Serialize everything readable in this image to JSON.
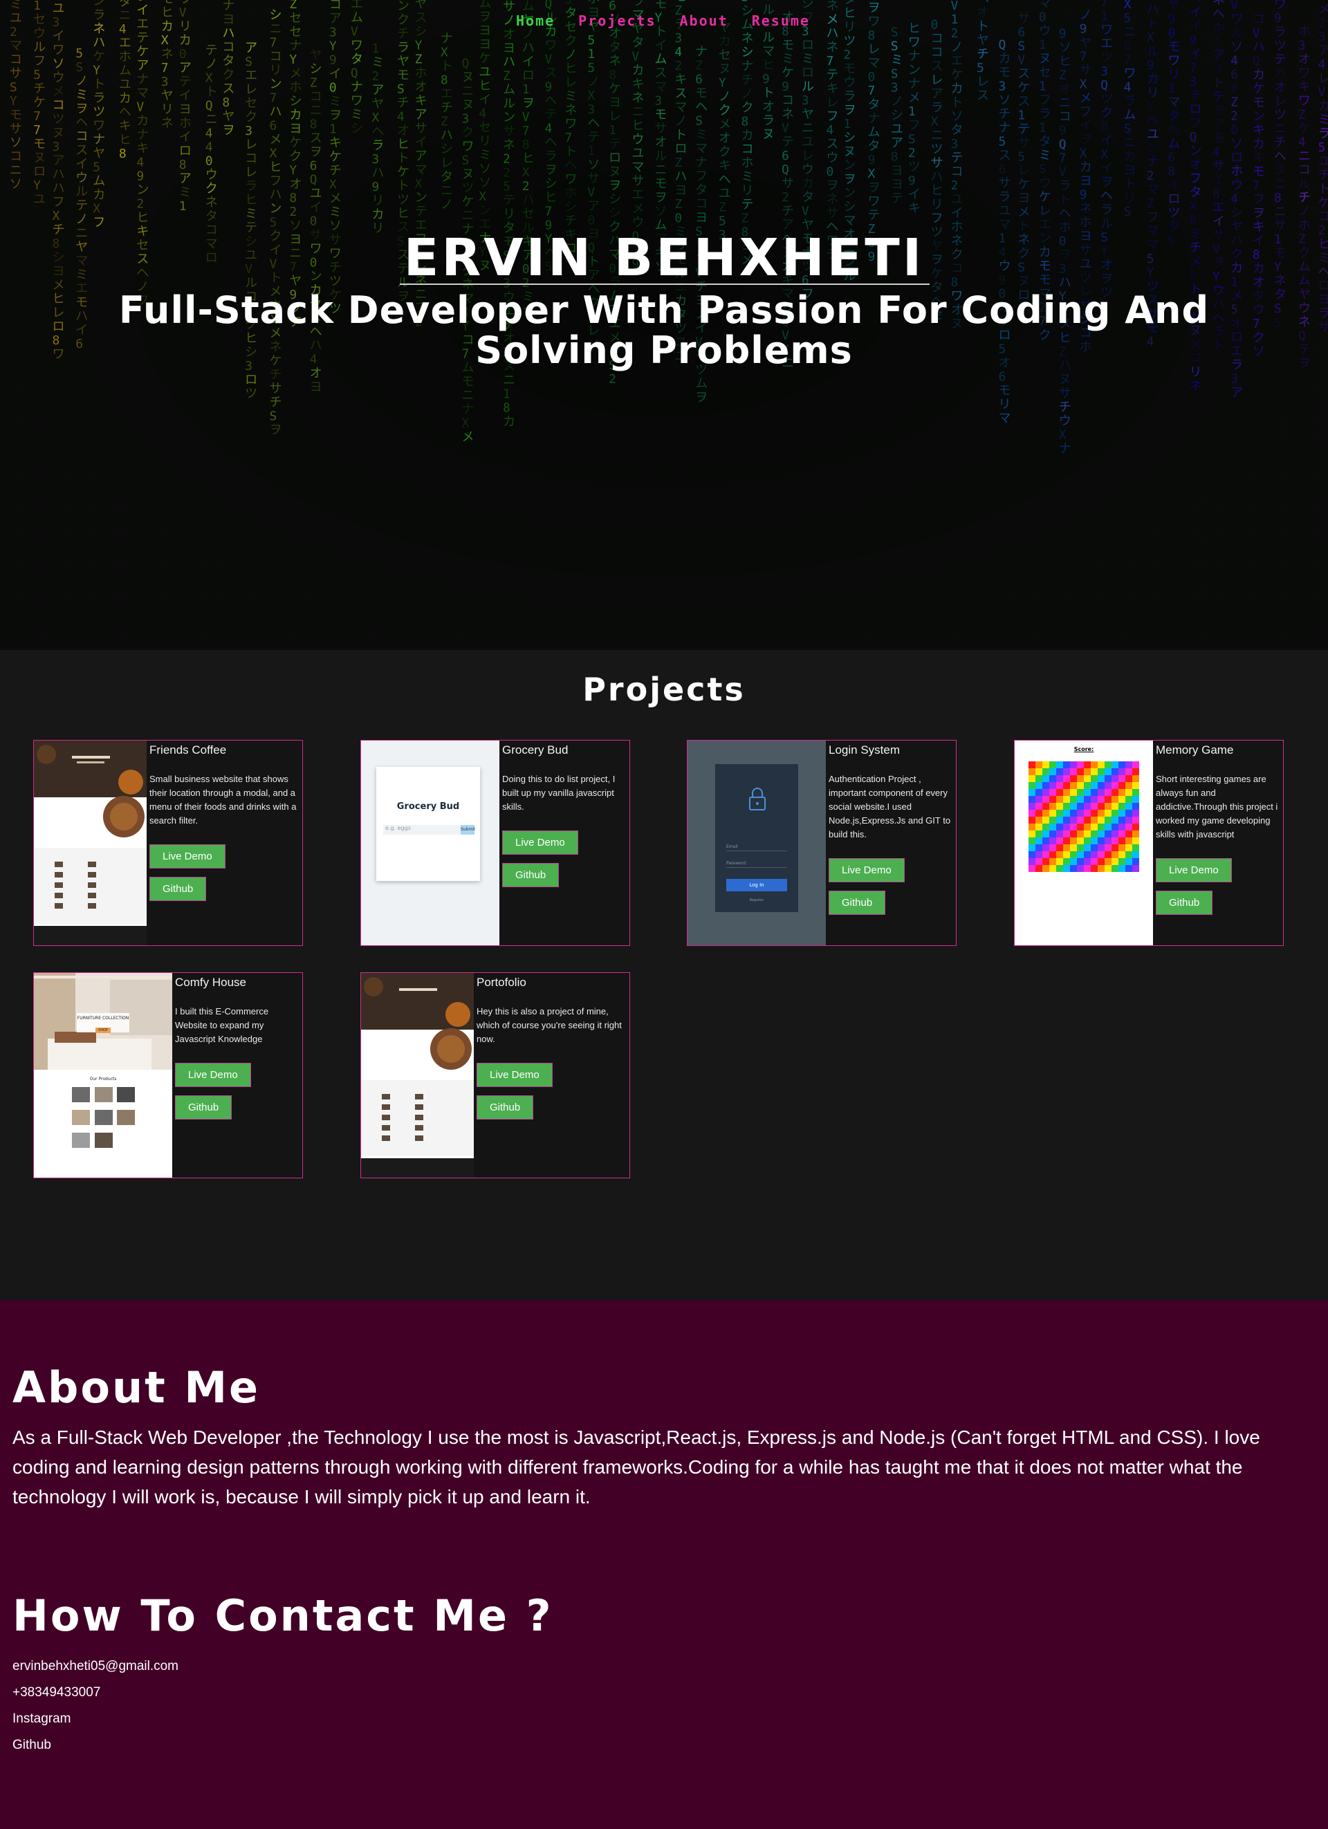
{
  "nav": {
    "items": [
      {
        "label": "Home",
        "active": true
      },
      {
        "label": "Projects",
        "active": false
      },
      {
        "label": "About",
        "active": false
      },
      {
        "label": "Resume",
        "active": false
      }
    ]
  },
  "hero": {
    "title": "ERVIN BEHXHETI",
    "subtitle": "Full-Stack Developer With Passion For Coding And Solving Problems"
  },
  "projects": {
    "heading": "Projects",
    "live_label": "Live Demo",
    "github_label": "Github",
    "cards": [
      {
        "title": "Friends Coffee",
        "desc": "Small business website that shows their location through a modal, and a menu of their foods and drinks with a search filter."
      },
      {
        "title": "Grocery Bud",
        "desc": "Doing this to do list project, I built up my vanilla javascript skills.",
        "thumb_text": "Grocery Bud",
        "thumb_button": "Submit",
        "thumb_placeholder": "e.g. eggs"
      },
      {
        "title": "Login System",
        "desc": "Authentication Project , important component of every social website.I used Node.js,Express.Js and GIT to build this.",
        "thumb_email": "Email",
        "thumb_password": "Password",
        "thumb_button": "Log In",
        "thumb_link": "Register"
      },
      {
        "title": "Memory Game",
        "desc": "Short interesting games are always fun and addictive.Through this project i worked my game developing skills with javascript",
        "thumb_text": "Score:"
      },
      {
        "title": "Comfy House",
        "desc": "I built this E-Commerce Website to expand my Javascript Knowledge",
        "thumb_text": "FURNITURE COLLECTION",
        "thumb_button": "SHOP",
        "thumb_sub": "Our Products"
      },
      {
        "title": "Portofolio",
        "desc": "Hey this is also a project of mine, which of course you're seeing it right now."
      }
    ]
  },
  "about": {
    "heading": "About Me",
    "text": "As a Full-Stack Web Developer ,the Technology I use the most is Javascript,React.js, Express.js and Node.js (Can't forget HTML and CSS). I love coding and learning design patterns through working with different frameworks.Coding for a while has taught me that it does not matter what the technology I will work is, because I will simply pick it up and learn it."
  },
  "contact": {
    "heading": "How To Contact Me ?",
    "email": "ervinbehxheti05@gmail.com",
    "phone": "+38349433007",
    "instagram": "Instagram",
    "github": "Github"
  },
  "colors": {
    "accent_pink": "#e62ea3",
    "nav_active_green": "#3bd14a",
    "button_green": "#4caf50",
    "about_bg": "#420027",
    "projects_bg": "#171717"
  }
}
